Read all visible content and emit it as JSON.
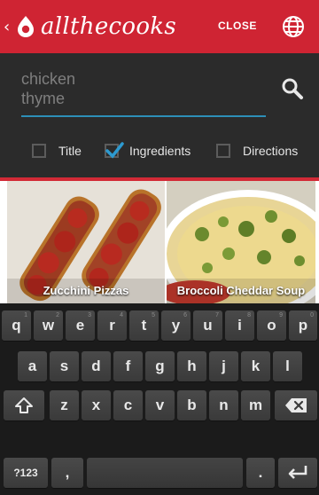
{
  "app": {
    "brand": "allthecooks",
    "close_label": "CLOSE"
  },
  "search": {
    "query": "chicken\nthyme"
  },
  "filters": [
    {
      "label": "Title",
      "checked": false
    },
    {
      "label": "Ingredients",
      "checked": true
    },
    {
      "label": "Directions",
      "checked": false
    }
  ],
  "recipes": [
    {
      "title": "Zucchini Pizzas"
    },
    {
      "title": "Broccoli Cheddar Soup"
    }
  ],
  "keyboard": {
    "row1": [
      "q",
      "w",
      "e",
      "r",
      "t",
      "y",
      "u",
      "i",
      "o",
      "p"
    ],
    "row1_hints": [
      "1",
      "2",
      "3",
      "4",
      "5",
      "6",
      "7",
      "8",
      "9",
      "0"
    ],
    "row2": [
      "a",
      "s",
      "d",
      "f",
      "g",
      "h",
      "j",
      "k",
      "l"
    ],
    "row3": [
      "z",
      "x",
      "c",
      "v",
      "b",
      "n",
      "m"
    ],
    "symbols_label": "?123",
    "comma_label": ",",
    "period_label": "."
  },
  "colors": {
    "brand_red": "#cf2433",
    "accent_blue": "#2d8fb8"
  }
}
